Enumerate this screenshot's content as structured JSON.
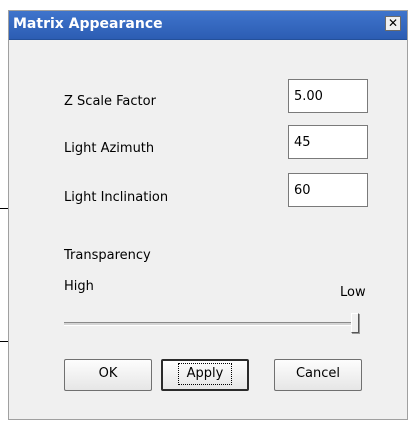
{
  "dialog": {
    "title": "Matrix Appearance",
    "close_label": "✕"
  },
  "fields": {
    "z_scale": {
      "label": "Z Scale Factor",
      "value": "5.00"
    },
    "azimuth": {
      "label": "Light Azimuth",
      "value": "45"
    },
    "inclination": {
      "label": "Light Inclination",
      "value": "60"
    }
  },
  "transparency": {
    "label": "Transparency",
    "high_label": "High",
    "low_label": "Low",
    "level": 1.0
  },
  "buttons": {
    "ok": "OK",
    "apply": "Apply",
    "cancel": "Cancel"
  },
  "colors": {
    "titlebar": "#2f62bd",
    "title_text": "#ffffff",
    "dialog_bg": "#f0f0f0"
  }
}
